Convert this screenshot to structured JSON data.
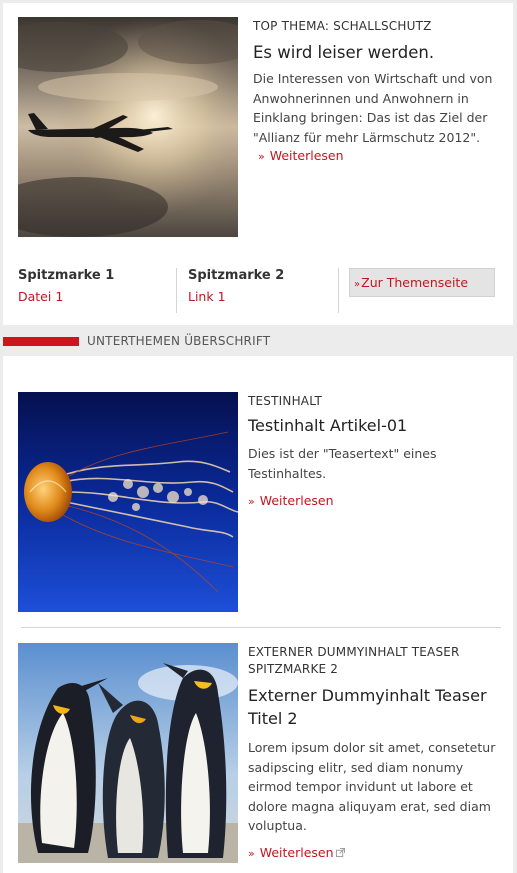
{
  "top_story": {
    "kicker": "TOP THEMA: SCHALLSCHUTZ",
    "title": "Es wird leiser werden.",
    "body_lines": [
      "Die Interessen von Wirtschaft und von",
      "Anwohnerinnen und Anwohnern in",
      "Einklang bringen: Das ist das Ziel der",
      "\"Allianz für mehr Lärmschutz 2012\"."
    ],
    "read_more": "Weiterlesen",
    "image": "airplane-sunset-image"
  },
  "spitzmarken": [
    {
      "label": "Spitzmarke 1",
      "link": "Datei 1"
    },
    {
      "label": "Spitzmarke 2",
      "link": "Link 1"
    }
  ],
  "theme_button": "Zur Themenseite",
  "section": {
    "title": "UNTERTHEMEN ÜBERSCHRIFT",
    "accent": "#d0141e"
  },
  "articles": [
    {
      "kicker": "TESTINHALT",
      "title": "Testinhalt Artikel-01",
      "body_lines": [
        "Dies ist der \"Teasertext\" eines",
        "Testinhaltes."
      ],
      "read_more": "Weiterlesen",
      "image": "jellyfish-image"
    },
    {
      "kicker_lines": [
        "EXTERNER DUMMYINHALT TEASER",
        "SPITZMARKE 2"
      ],
      "title_lines": [
        "Externer Dummyinhalt Teaser",
        "Titel 2"
      ],
      "body_lines": [
        "Lorem ipsum dolor sit amet, consetetur",
        "sadipscing elitr, sed diam nonumy",
        "eirmod tempor invidunt ut labore et",
        "dolore magna aliquyam erat, sed diam",
        "voluptua."
      ],
      "read_more": "Weiterlesen",
      "image": "penguins-image",
      "external": true
    }
  ],
  "colors": {
    "link": "#c0171f",
    "background": "#ececec",
    "card": "#ffffff"
  }
}
